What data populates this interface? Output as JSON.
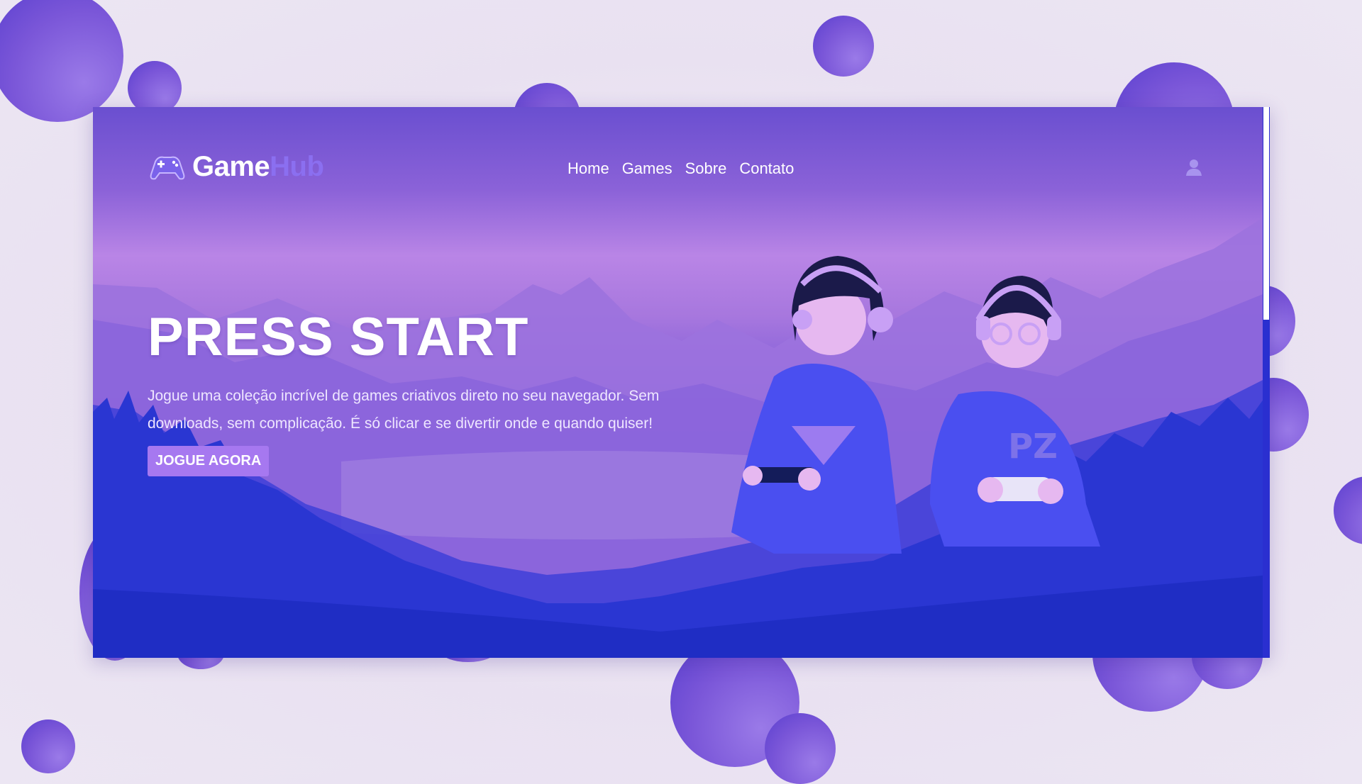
{
  "brand": {
    "name_primary": "Game",
    "name_accent": "Hub",
    "logo_icon": "gamepad-icon",
    "accent_color": "#8b6ff0"
  },
  "nav": {
    "items": [
      {
        "label": "Home"
      },
      {
        "label": "Games"
      },
      {
        "label": "Sobre"
      },
      {
        "label": "Contato"
      }
    ],
    "user_icon": "user-icon"
  },
  "hero": {
    "title": "PRESS START",
    "description": "Jogue uma coleção incrível de games criativos direto no seu navegador. Sem downloads, sem complicação. É só clicar e se divertir onde e quando quiser!",
    "cta_label": "JOGUE AGORA",
    "cta_color": "#a678f0"
  },
  "colors": {
    "bubble": "#7a56d8",
    "background": "#ece6f3"
  }
}
